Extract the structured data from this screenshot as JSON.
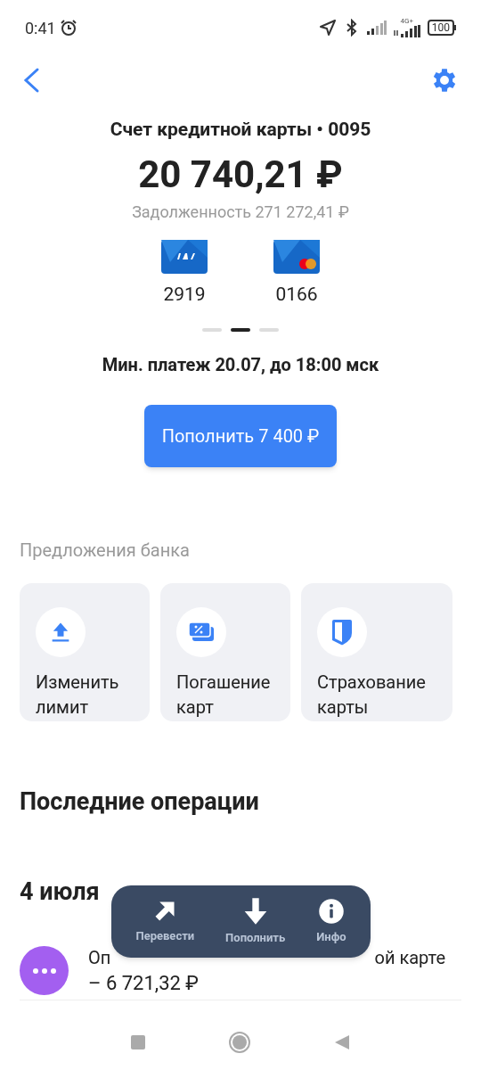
{
  "status_bar": {
    "time": "0:41",
    "network": "4G+",
    "battery": "100"
  },
  "account": {
    "title": "Счет кредитной карты • 0095",
    "balance": "20 740,21 ₽",
    "debt": "Задолженность 271 272,41 ₽"
  },
  "cards": [
    {
      "kind": "visa",
      "number": "2919"
    },
    {
      "kind": "mastercard",
      "number": "0166"
    }
  ],
  "pager": [
    {
      "selected": false
    },
    {
      "selected": true
    },
    {
      "selected": false
    }
  ],
  "min_payment": "Мин. платеж 20.07, до 18:00 мск",
  "topup_button": "Пополнить 7 400 ₽",
  "offers": {
    "title": "Предложения банка",
    "items": [
      {
        "kind": "limit",
        "label": "Изменить лимит"
      },
      {
        "kind": "repay",
        "label": "Погашение карт"
      },
      {
        "kind": "insurance",
        "label": "Страхование карты"
      }
    ]
  },
  "operations": {
    "title": "Последние операции",
    "date": "4 июля",
    "transaction": {
      "title_start": "Оп",
      "title_end": "ой карте",
      "amount": "– 6 721,32 ₽",
      "color": "#a35ff0"
    }
  },
  "popup_menu": [
    {
      "kind": "transfer",
      "label": "Перевести"
    },
    {
      "kind": "topup",
      "label": "Пополнить"
    },
    {
      "kind": "info",
      "label": "Инфо"
    }
  ]
}
